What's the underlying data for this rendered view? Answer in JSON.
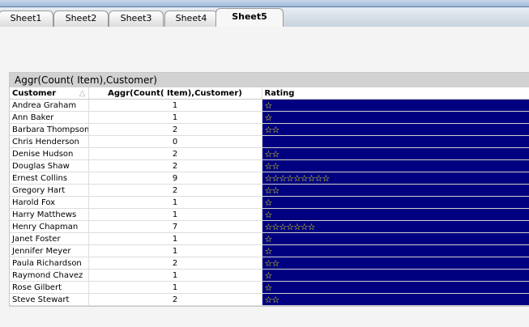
{
  "tabs": [
    "Sheet1",
    "Sheet2",
    "Sheet3",
    "Sheet4",
    "Sheet5"
  ],
  "active_tab": "Sheet5",
  "table": {
    "title": "Aggr(Count( Item),Customer)",
    "headers": [
      "Customer",
      "Aggr(Count( Item),Customer)",
      "Rating"
    ],
    "sort_icon": "△",
    "star_glyph": "☆",
    "star_color": "#ffff00",
    "rating_bg": "#000080",
    "rows": [
      {
        "customer": "Andrea Graham",
        "count": 1
      },
      {
        "customer": "Ann Baker",
        "count": 1
      },
      {
        "customer": "Barbara Thompson",
        "count": 2
      },
      {
        "customer": "Chris Henderson",
        "count": 0
      },
      {
        "customer": "Denise Hudson",
        "count": 2
      },
      {
        "customer": "Douglas Shaw",
        "count": 2
      },
      {
        "customer": "Ernest Collins",
        "count": 9
      },
      {
        "customer": "Gregory Hart",
        "count": 2
      },
      {
        "customer": "Harold Fox",
        "count": 1
      },
      {
        "customer": "Harry Matthews",
        "count": 1
      },
      {
        "customer": "Henry Chapman",
        "count": 7
      },
      {
        "customer": "Janet Foster",
        "count": 1
      },
      {
        "customer": "Jennifer Meyer",
        "count": 1
      },
      {
        "customer": "Paula Richardson",
        "count": 2
      },
      {
        "customer": "Raymond Chavez",
        "count": 1
      },
      {
        "customer": "Rose Gilbert",
        "count": 1
      },
      {
        "customer": "Steve Stewart",
        "count": 2
      }
    ]
  }
}
